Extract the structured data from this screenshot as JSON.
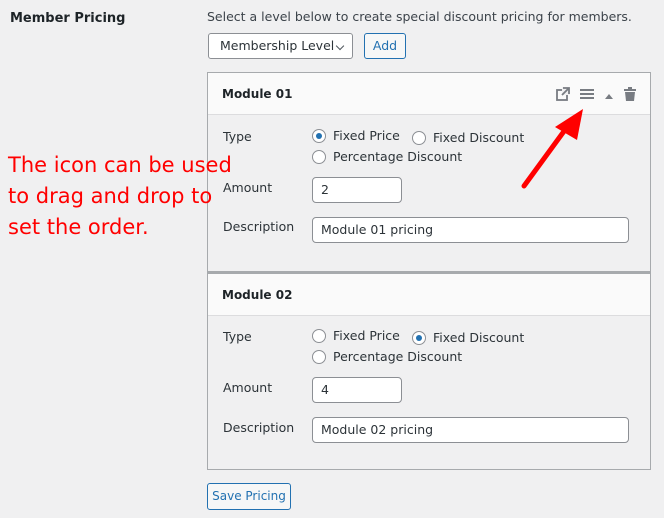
{
  "field": {
    "label": "Member Pricing",
    "hint": "Select a level below to create special discount pricing for members."
  },
  "controls": {
    "level_select": "Membership Level",
    "add_label": "Add",
    "save_label": "Save Pricing"
  },
  "labels": {
    "type": "Type",
    "amount": "Amount",
    "description": "Description"
  },
  "type_options": [
    "Fixed Price",
    "Fixed Discount",
    "Percentage Discount"
  ],
  "modules": [
    {
      "title": "Module 01",
      "selected_type": "Fixed Price",
      "amount": "2",
      "description": "Module 01 pricing",
      "icons": [
        "external-link-icon",
        "drag-handle-icon",
        "collapse-up-icon",
        "trash-icon"
      ]
    },
    {
      "title": "Module 02",
      "selected_type": "Fixed Discount",
      "amount": "4",
      "description": "Module 02 pricing"
    }
  ],
  "annotation": {
    "text": "The icon can be used to drag and drop to set the order.",
    "color": "#ff0000"
  },
  "colors": {
    "accent": "#2271b1",
    "background": "#f0f0f1"
  }
}
